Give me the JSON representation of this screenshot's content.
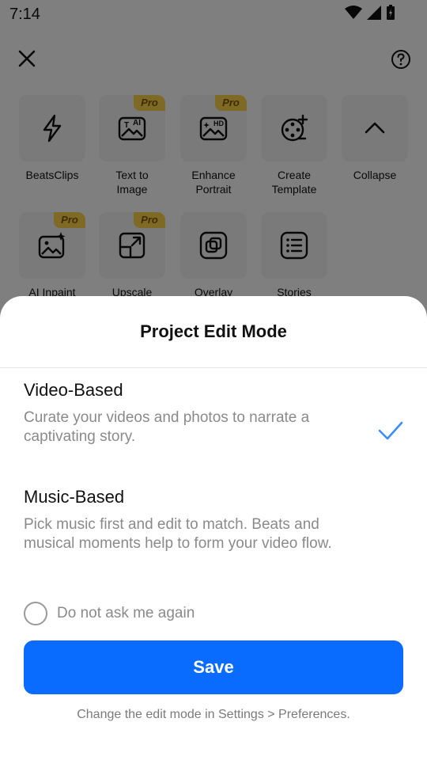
{
  "status_bar": {
    "time": "7:14"
  },
  "tools": [
    {
      "label": "BeatsClips",
      "icon": "lightning-icon",
      "pro": false
    },
    {
      "label": "Text to\nImage",
      "icon": "text-to-image-icon",
      "pro": true
    },
    {
      "label": "Enhance\nPortrait",
      "icon": "hd-image-icon",
      "pro": true
    },
    {
      "label": "Create\nTemplate",
      "icon": "film-reel-plus-icon",
      "pro": false
    },
    {
      "label": "Collapse",
      "icon": "chevron-up-icon",
      "pro": false
    },
    {
      "label": "AI Inpaint",
      "icon": "image-sparkle-icon",
      "pro": true
    },
    {
      "label": "Upscale",
      "icon": "upscale-arrow-icon",
      "pro": true
    },
    {
      "label": "Overlay",
      "icon": "overlay-squares-icon",
      "pro": false
    },
    {
      "label": "Stories",
      "icon": "list-icon",
      "pro": false
    }
  ],
  "pro_badge_text": "Pro",
  "sheet": {
    "title": "Project Edit Mode",
    "options": [
      {
        "title": "Video-Based",
        "description": "Curate your videos and photos to narrate a captivating story.",
        "selected": true
      },
      {
        "title": "Music-Based",
        "description": "Pick music first and edit to match. Beats and musical moments help to form your video flow.",
        "selected": false
      }
    ],
    "dont_ask_label": "Do not ask me again",
    "save_label": "Save",
    "footer_note": "Change the edit mode in Settings > Preferences."
  },
  "colors": {
    "primary": "#0a6cff",
    "check": "#3b8bff",
    "pro_badge": "#ffd54a"
  }
}
